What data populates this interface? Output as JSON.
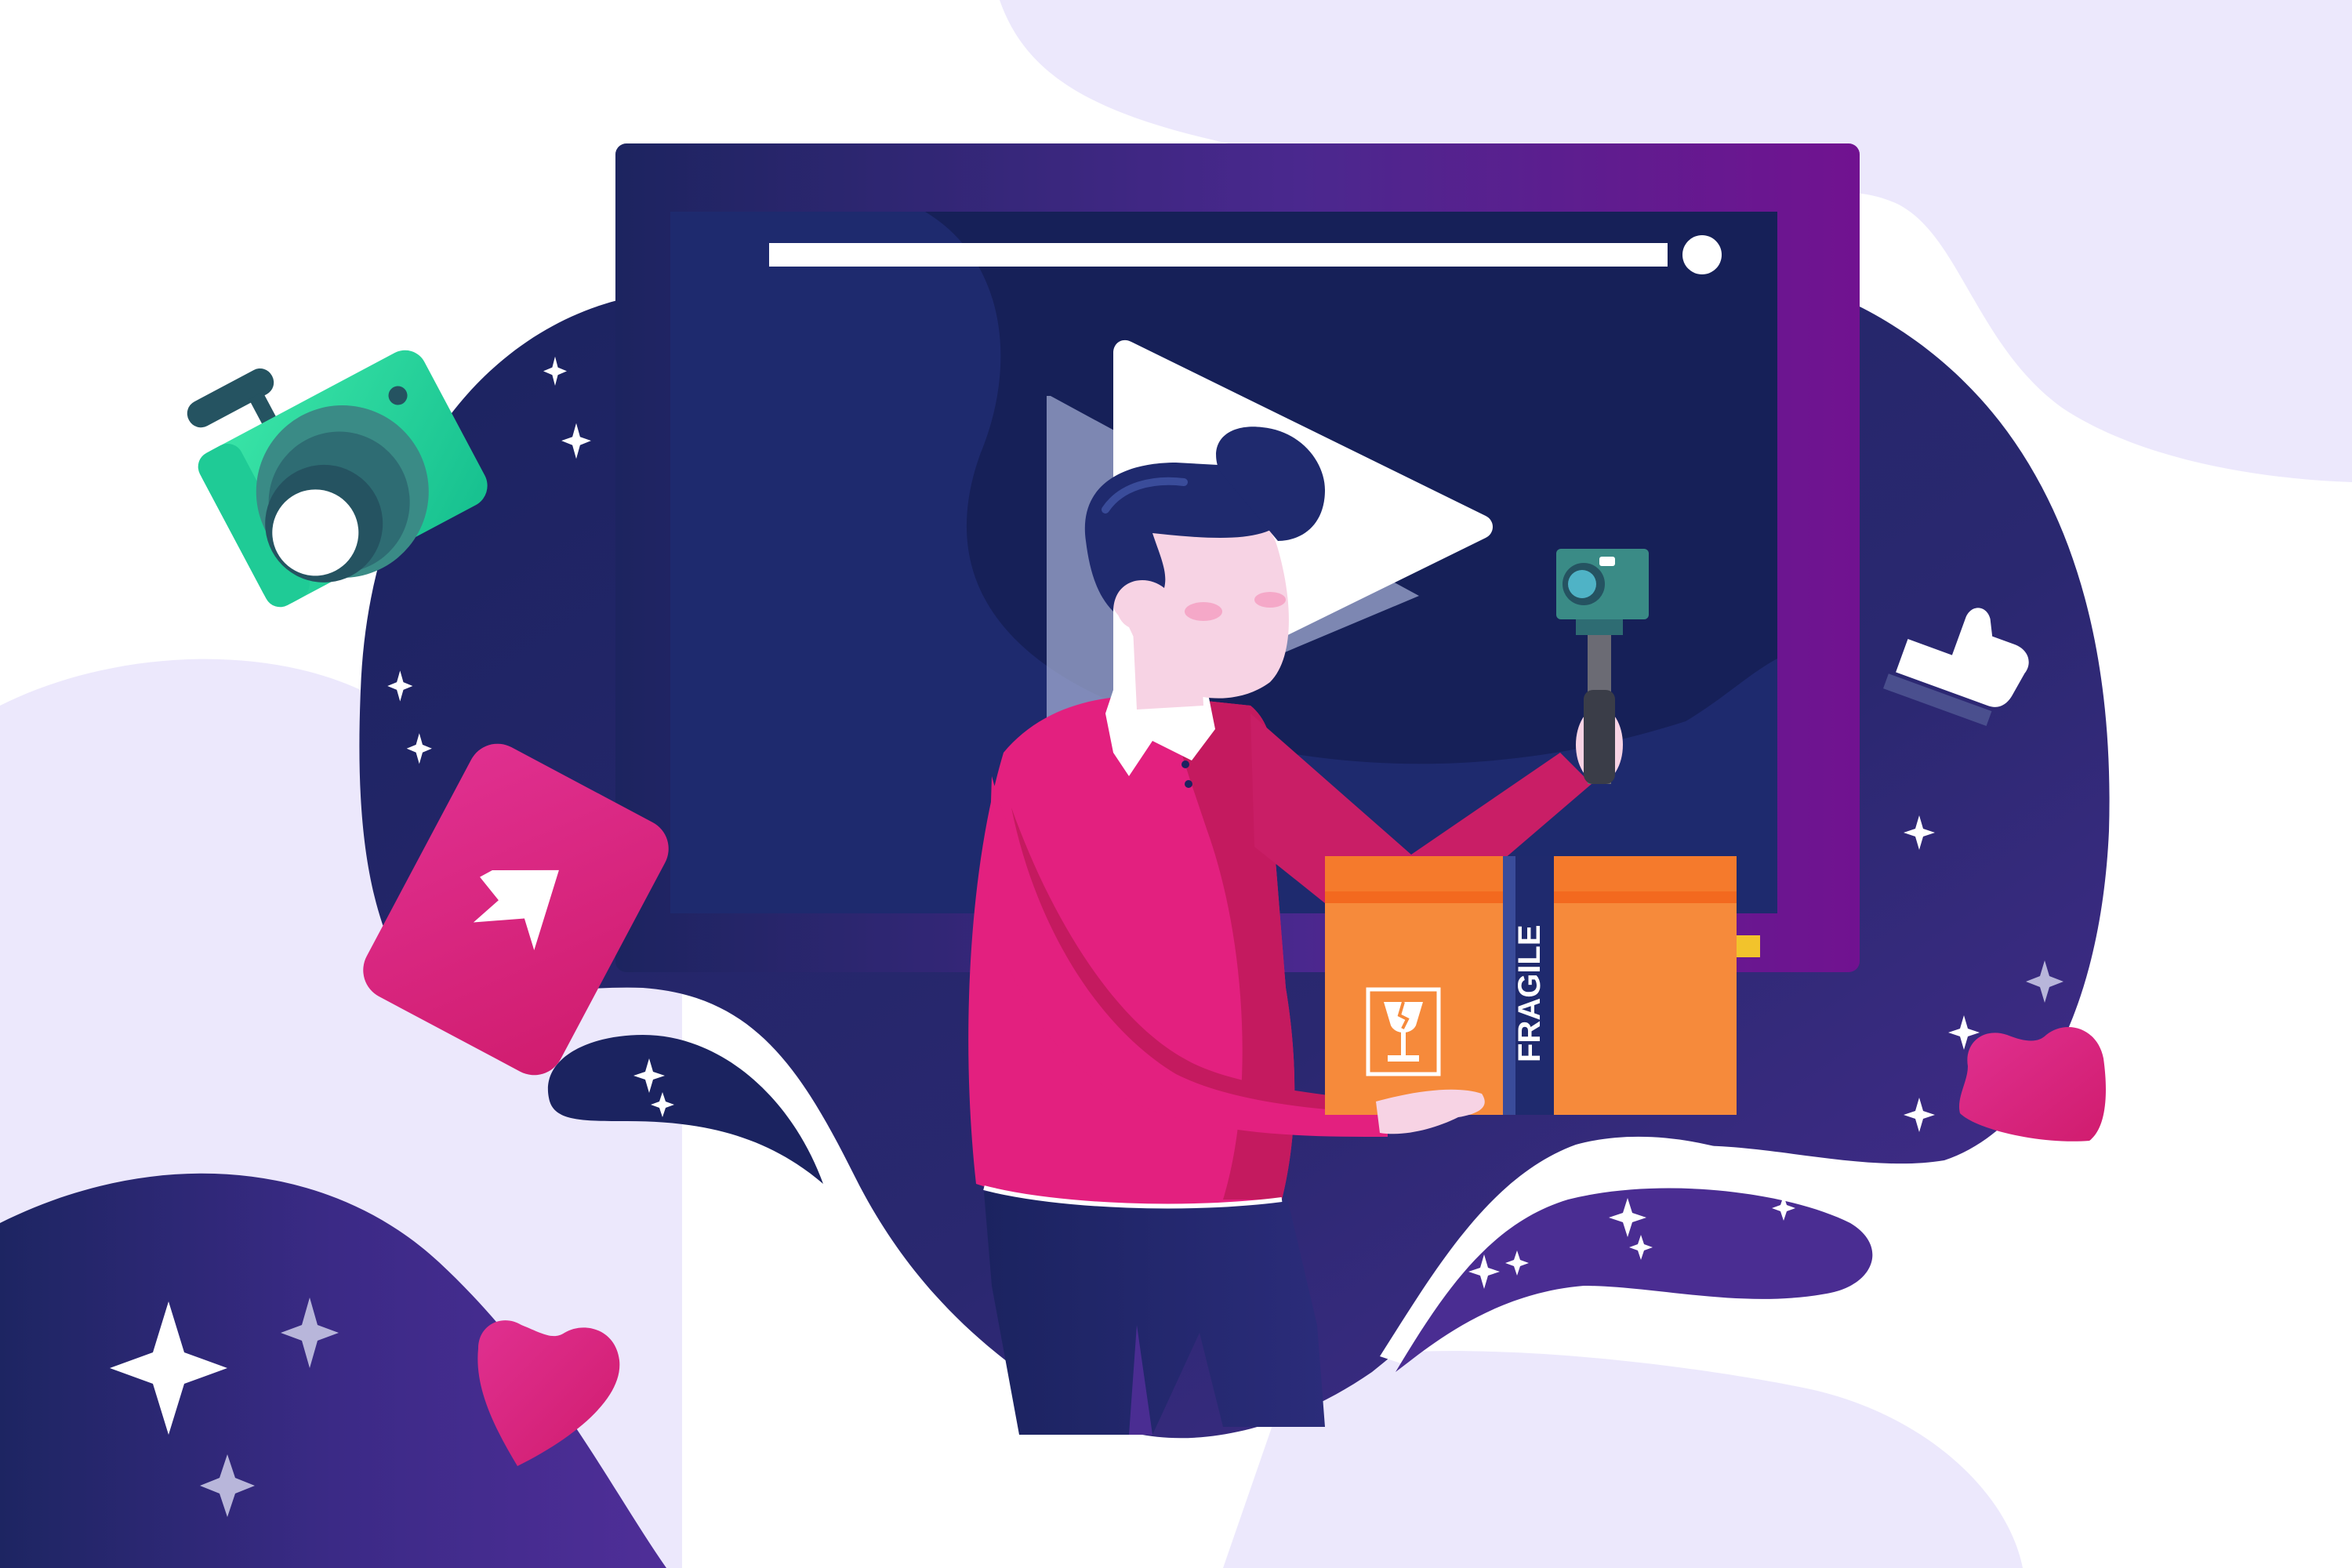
{
  "illustration": {
    "box_label": "FRAGILE"
  },
  "colors": {
    "background": "#ffffff",
    "lavender": "#ECE8FC",
    "navy": "#1B2360",
    "purple": "#4A2D92",
    "magenta": "#8E0DA0",
    "pink": "#E3207F",
    "orange": "#F68A3B",
    "teal": "#25D9A0",
    "skin": "#F7D3E4"
  },
  "icons": [
    "camera-icon",
    "play-icon",
    "share-arrow-icon",
    "heart-icon",
    "thumbs-up-icon",
    "fragile-glass-icon",
    "sparkle-icon"
  ]
}
